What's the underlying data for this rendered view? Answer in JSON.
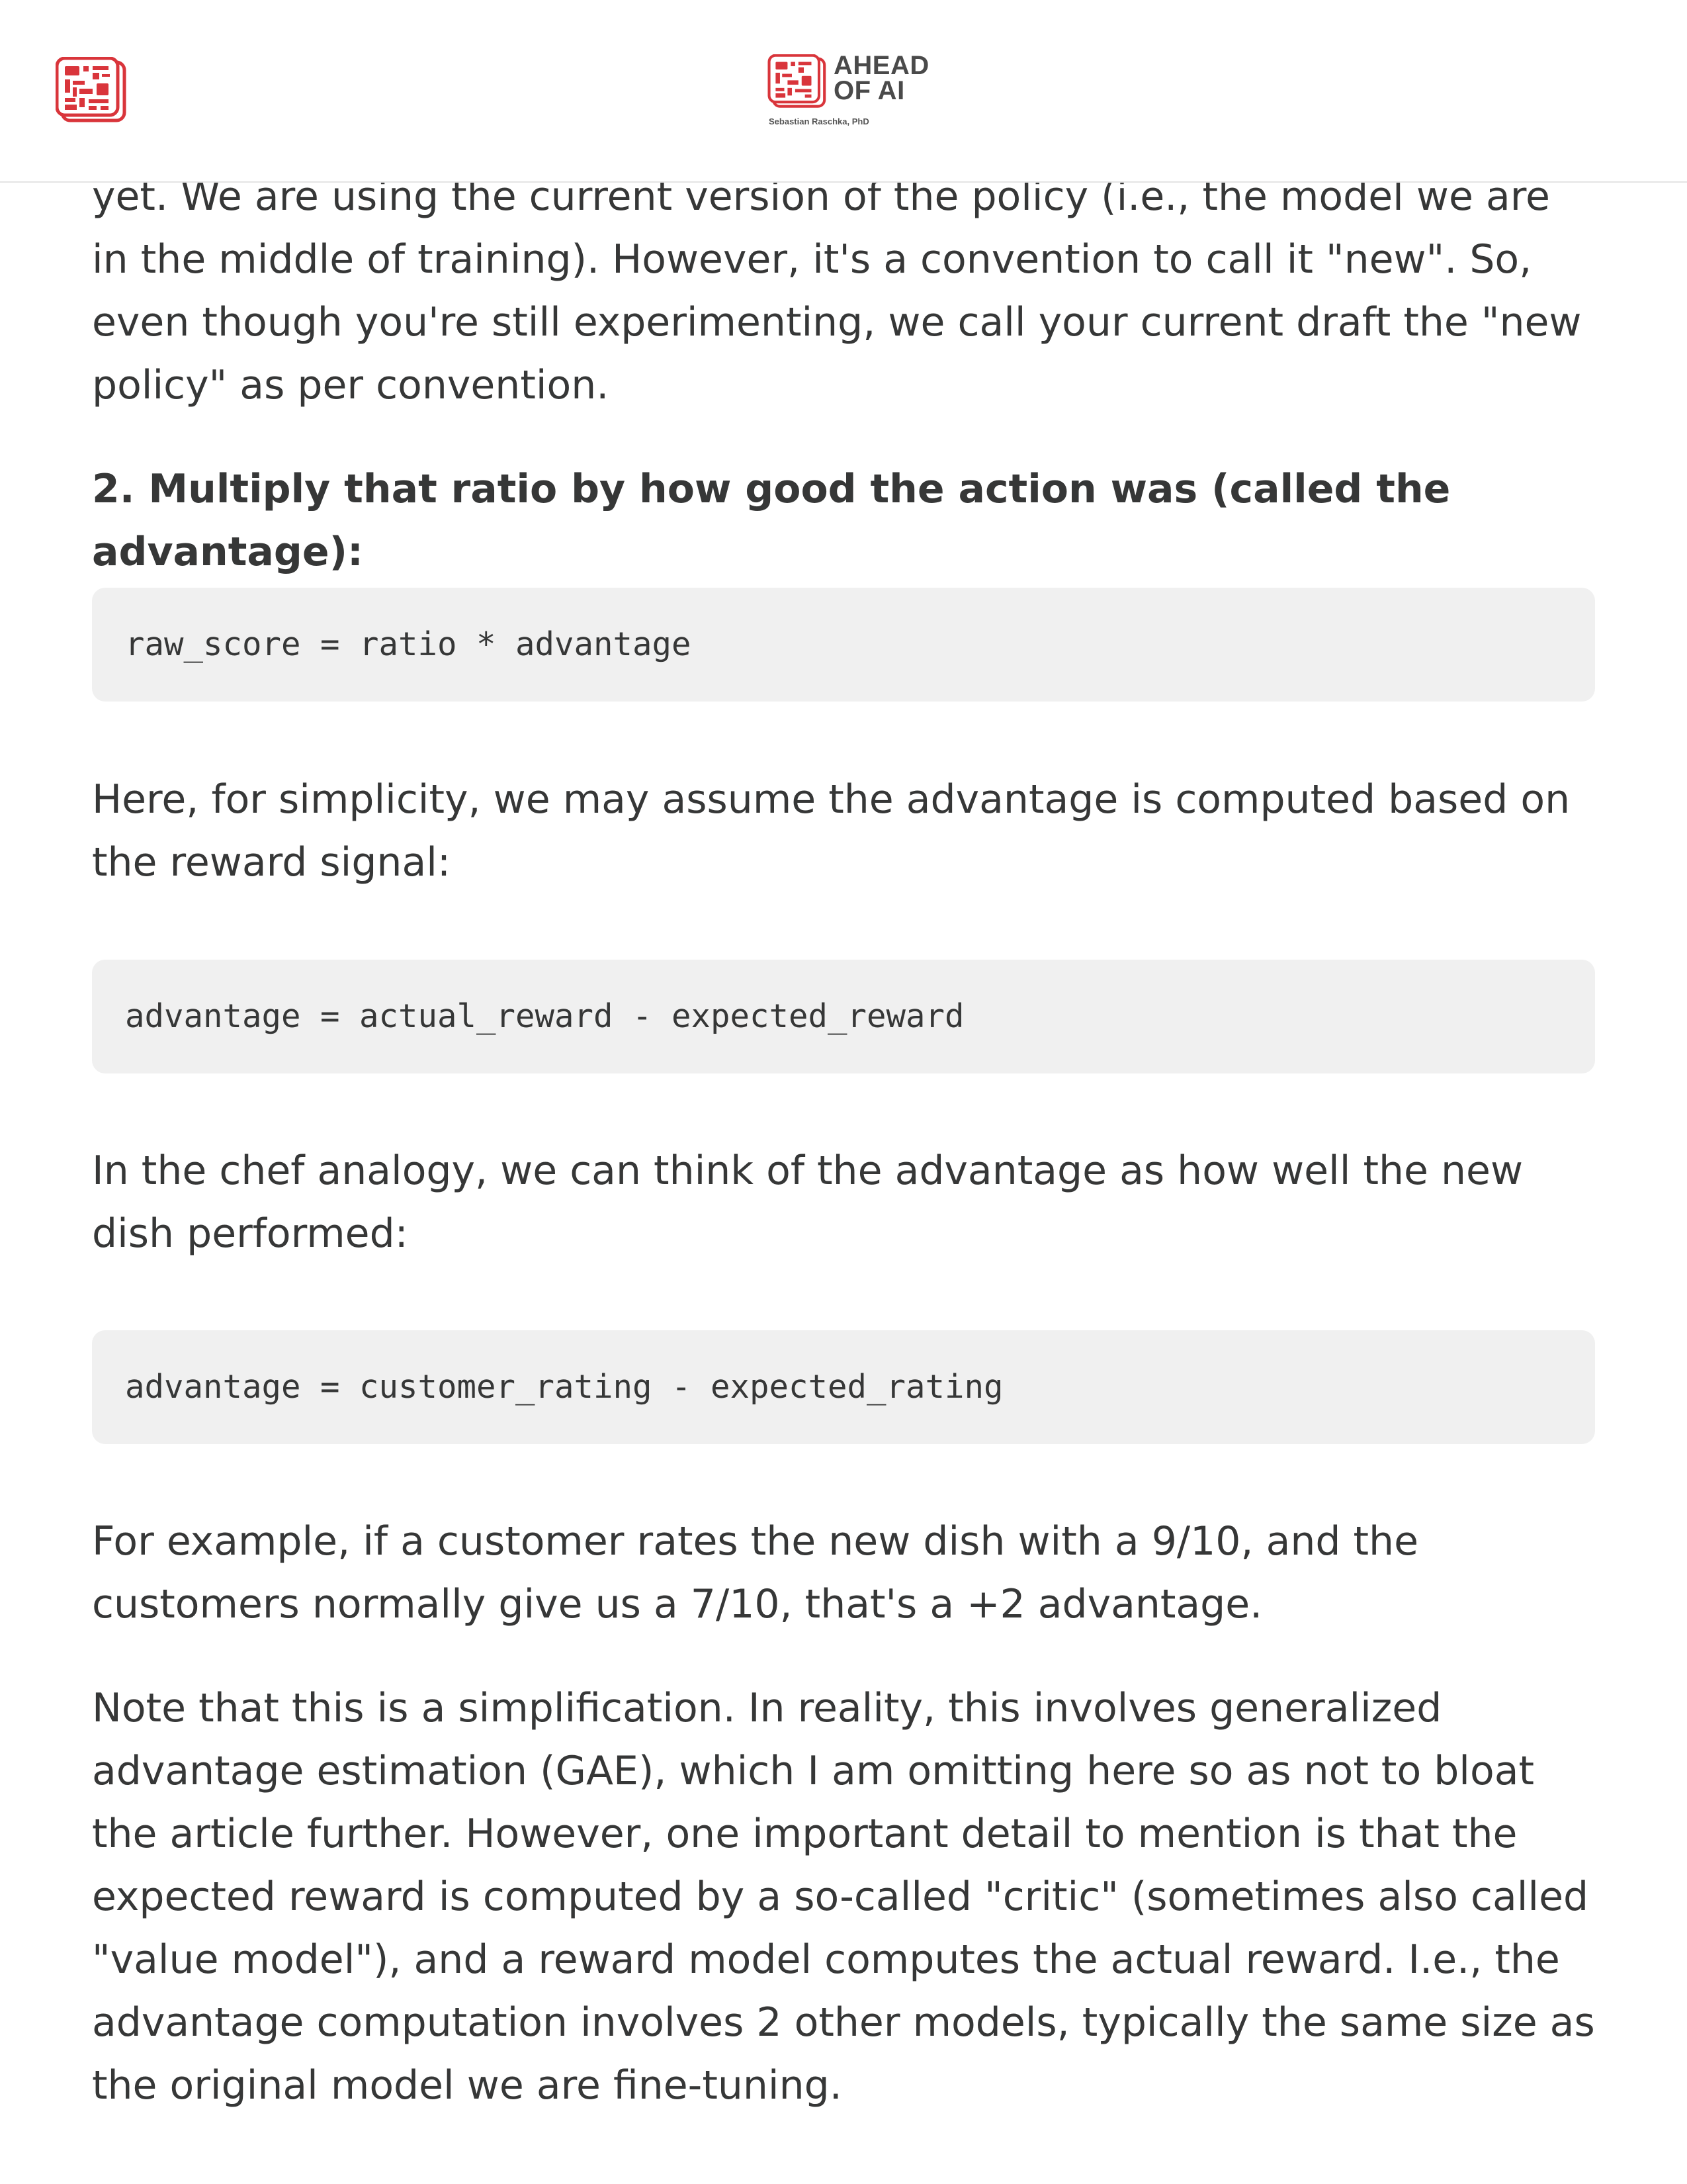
{
  "header": {
    "brand_line1": "AHEAD",
    "brand_line2": "OF AI",
    "byline": "Sebastian Raschka, PhD"
  },
  "article": {
    "p_intro": "yet. We are using the current version of the policy (i.e., the model we are in the middle of training). However, it's a convention to call it \"new\". So, even though you're still experimenting, we call your current draft the \"new policy\" as per convention.",
    "heading_step2": "2. Multiply that ratio by how good the action was (called the advantage):",
    "code_raw_score": "raw_score = ratio * advantage",
    "p_simplicity": "Here, for simplicity, we may assume the advantage is computed based on the reward signal:",
    "code_advantage_reward": "advantage = actual_reward - expected_reward",
    "p_chef": "In the chef analogy, we can think of the advantage as how well the new dish performed:",
    "code_advantage_rating": "advantage = customer_rating - expected_rating",
    "p_example": "For example, if a customer rates the new dish with a 9/10, and the customers normally give us a 7/10, that's a +2 advantage.",
    "p_note": "Note that this is a simplification. In reality, this involves generalized advantage estimation (GAE), which I am omitting here so as not to bloat the article further. However, one important detail to mention is that the expected reward is computed by a so-called \"critic\" (sometimes also called \"value model\"), and a reward model computes the actual reward. I.e., the advantage computation involves 2 other models, typically the same size as the original model we are fine-tuning."
  },
  "colors": {
    "text": "#363737",
    "code_bg": "#f0f0f0",
    "logo_red": "#d9353b"
  }
}
